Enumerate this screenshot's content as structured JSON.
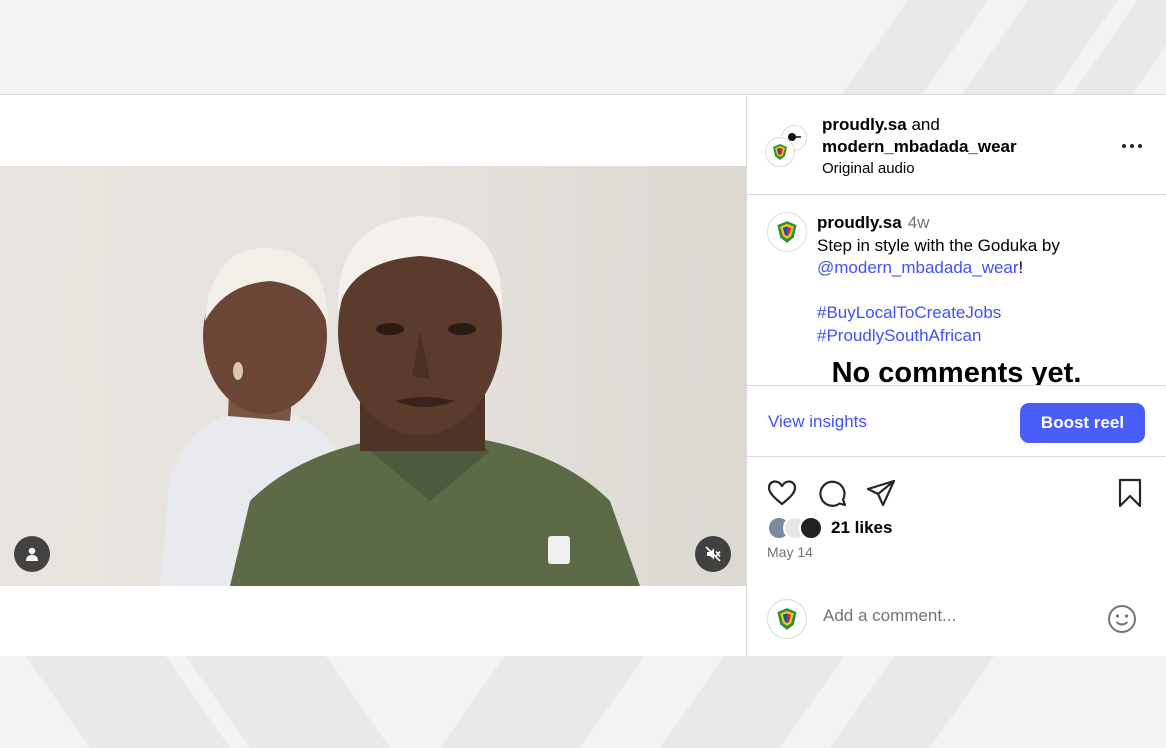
{
  "header": {
    "author": "proudly.sa",
    "joiner": "and",
    "collaborator": "modern_mbadada_wear",
    "audio": "Original audio"
  },
  "caption": {
    "author": "proudly.sa",
    "time": "4w",
    "text_before": "Step in style with the Goduka by",
    "mention": "@modern_mbadada_wear",
    "text_after": "!",
    "hashtag1": "#BuyLocalToCreateJobs",
    "hashtag2": "#ProudlySouthAfrican"
  },
  "no_comments": "No comments yet.",
  "insights": {
    "view_label": "View insights",
    "boost_label": "Boost reel"
  },
  "likes": {
    "text": "21 likes",
    "date": "May 14"
  },
  "comment_box": {
    "placeholder": "Add a comment..."
  },
  "colors": {
    "accent": "#4150f7",
    "boost": "#4a5df9",
    "muted": "#737373",
    "border": "#dbdbdb"
  },
  "icons": [
    "user-tag-icon",
    "mute-icon",
    "more-icon",
    "heart-icon",
    "comment-icon",
    "share-icon",
    "bookmark-icon",
    "emoji-icon"
  ]
}
